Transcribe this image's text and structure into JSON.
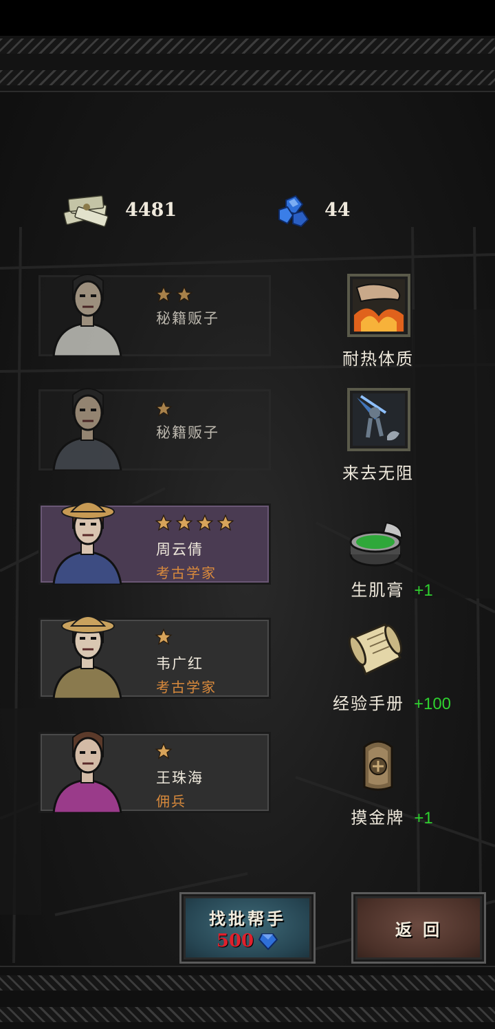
{
  "currency": {
    "money": "4481",
    "gems": "44"
  },
  "heroes": [
    {
      "stars": 2,
      "name": "秘籍贩子",
      "class": "",
      "style": "faded"
    },
    {
      "stars": 1,
      "name": "秘籍贩子",
      "class": "",
      "style": "faded"
    },
    {
      "stars": 4,
      "name": "周云倩",
      "class": "考古学家",
      "style": "rare"
    },
    {
      "stars": 1,
      "name": "韦广红",
      "class": "考古学家",
      "style": "solid"
    },
    {
      "stars": 1,
      "name": "王珠海",
      "class": "佣兵",
      "style": "solid"
    }
  ],
  "rewards": [
    {
      "name": "耐热体质",
      "bonus": "",
      "icon": "fire-arm-skill-icon"
    },
    {
      "name": "来去无阻",
      "bonus": "",
      "icon": "dash-skill-icon"
    },
    {
      "name": "生肌膏",
      "bonus": "+1",
      "icon": "ointment-tin-icon"
    },
    {
      "name": "经验手册",
      "bonus": "+100",
      "icon": "scroll-icon"
    },
    {
      "name": "摸金牌",
      "bonus": "+1",
      "icon": "amulet-icon"
    }
  ],
  "buttons": {
    "recruit_label": "找批帮手",
    "recruit_cost": "500",
    "back_label": "返 回"
  },
  "colors": {
    "class_text": "#d98a3c",
    "bonus_text": "#2fd12f",
    "cost_text": "#e0202c",
    "star": "#d8a45a"
  }
}
